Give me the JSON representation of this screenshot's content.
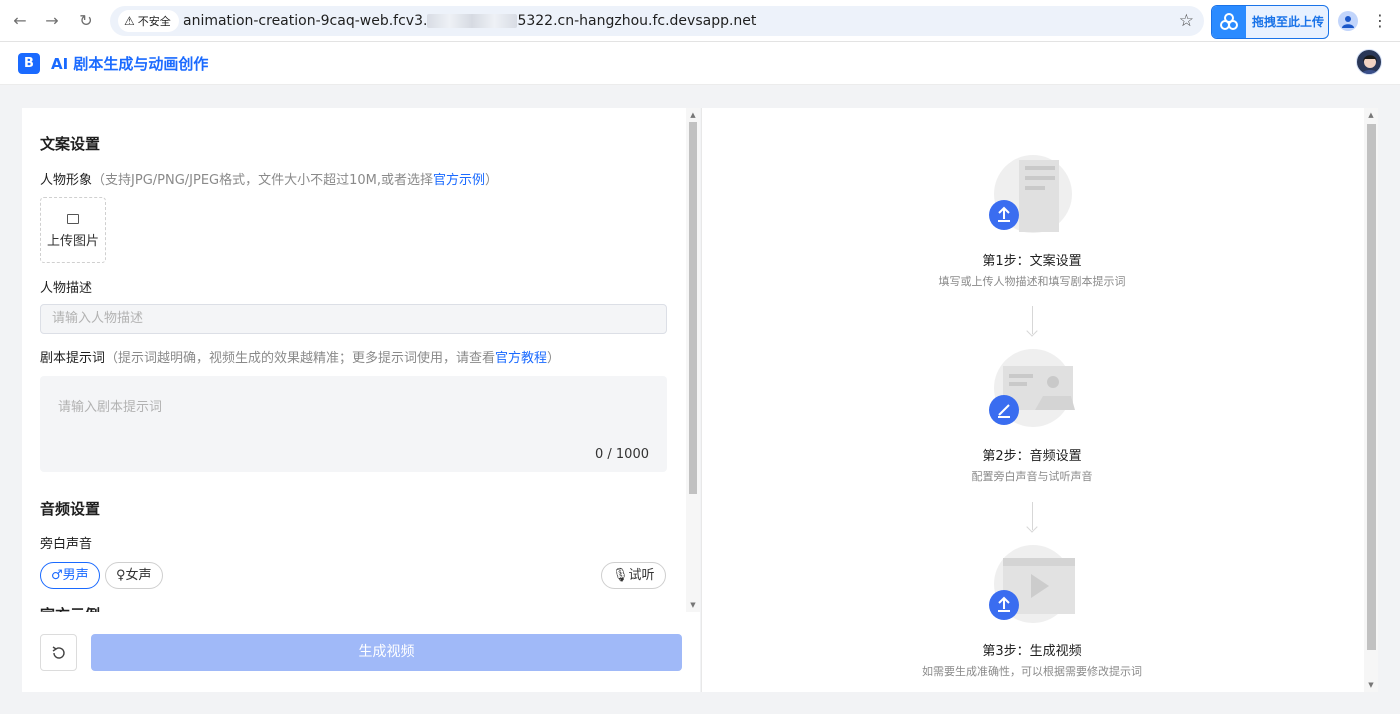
{
  "browser": {
    "security_label": "不安全",
    "url_prefix": "animation-creation-9caq-web.fcv3.",
    "url_suffix": "5322.cn-hangzhou.fc.devsapp.net",
    "extension_label": "拖拽至此上传",
    "icons": [
      "back-icon",
      "forward-icon",
      "reload-icon",
      "warning-icon",
      "star-icon",
      "cloud-extension-icon",
      "profile-icon",
      "menu-dots-icon"
    ]
  },
  "app": {
    "logo_text": "B",
    "title": "AI 剧本生成与动画创作"
  },
  "form": {
    "copy_section_title": "文案设置",
    "character_label": "人物形象",
    "character_hint": "（支持JPG/PNG/JPEG格式，文件大小不超过10M,或者选择",
    "character_link": "官方示例",
    "character_hint_end": "）",
    "upload_label": "上传图片",
    "desc_label": "人物描述",
    "desc_placeholder": "请输入人物描述",
    "prompt_label": "剧本提示词",
    "prompt_hint": "（提示词越明确，视频生成的效果越精准；更多提示词使用，请查看",
    "prompt_link": "官方教程",
    "prompt_hint_end": "）",
    "prompt_placeholder": "请输入剧本提示词",
    "prompt_count": "0 / 1000",
    "audio_section_title": "音频设置",
    "narration_label": "旁白声音",
    "voice_options": [
      "♂男声",
      "♀女声"
    ],
    "selected_voice": "♂男声",
    "preview_label": "🎙试听",
    "cut_section_title": "官方示例",
    "generate_label": "生成视频"
  },
  "steps": [
    {
      "title": "第1步：文案设置",
      "desc": "填写或上传人物描述和填写剧本提示词"
    },
    {
      "title": "第2步：音频设置",
      "desc": "配置旁白声音与试听声音"
    },
    {
      "title": "第3步：生成视频",
      "desc": "如需要生成准确性，可以根据需要修改提示词"
    }
  ],
  "colors": {
    "brand": "#1a6aff",
    "generate_disabled": "#a0b9f8",
    "badge": "#3a6df0"
  }
}
